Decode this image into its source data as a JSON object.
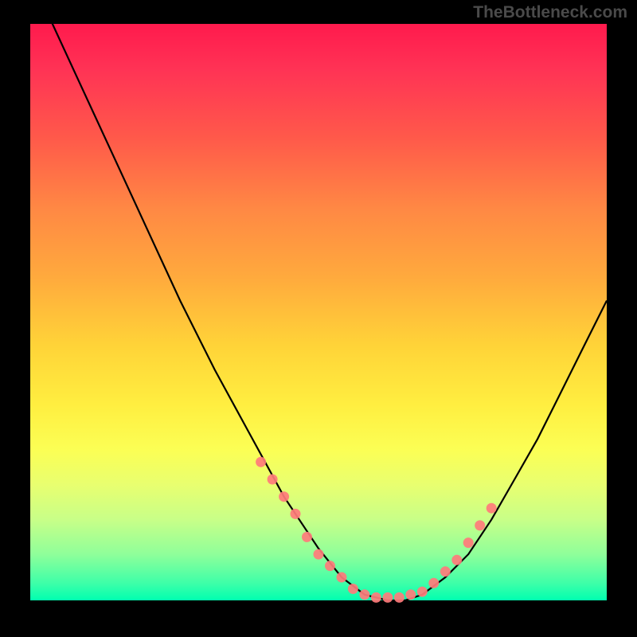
{
  "watermark": "TheBottleneck.com",
  "chart_data": {
    "type": "line",
    "title": "",
    "xlabel": "",
    "ylabel": "",
    "xlim": [
      0,
      100
    ],
    "ylim": [
      0,
      100
    ],
    "series": [
      {
        "name": "curve",
        "x": [
          2,
          8,
          14,
          20,
          26,
          32,
          38,
          44,
          50,
          54,
          58,
          62,
          65,
          68,
          72,
          76,
          80,
          84,
          88,
          92,
          96,
          100
        ],
        "y": [
          104,
          91,
          78,
          65,
          52,
          40,
          29,
          18,
          9,
          4,
          1,
          0,
          0,
          1,
          4,
          8,
          14,
          21,
          28,
          36,
          44,
          52
        ]
      }
    ],
    "highlight_segments": [
      {
        "name": "left-dots",
        "x": [
          40,
          42,
          44,
          46,
          48,
          50,
          52,
          54
        ],
        "y": [
          24,
          21,
          18,
          15,
          11,
          8,
          6,
          4
        ]
      },
      {
        "name": "bottom-dots",
        "x": [
          56,
          58,
          60,
          62,
          64,
          66,
          68
        ],
        "y": [
          2,
          1,
          0.5,
          0.5,
          0.5,
          1,
          1.5
        ]
      },
      {
        "name": "right-dots",
        "x": [
          70,
          72,
          74,
          76,
          78,
          80
        ],
        "y": [
          3,
          5,
          7,
          10,
          13,
          16
        ]
      }
    ],
    "colors": {
      "curve": "#000000",
      "dots": "#ff7b7b",
      "gradient_top": "#ff1a4d",
      "gradient_mid": "#ffee40",
      "gradient_bottom": "#00ffb0"
    }
  }
}
